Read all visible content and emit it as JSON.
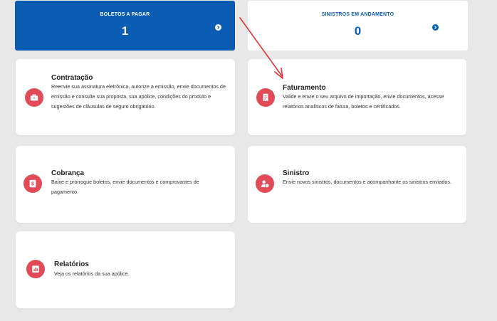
{
  "stats": {
    "boletos": {
      "label": "BOLETOS A PAGAR",
      "value": "1",
      "icon": "chevron-right-circle-icon"
    },
    "sinistros": {
      "label": "SINISTROS EM ANDAMENTO",
      "value": "0",
      "icon": "chevron-right-circle-icon"
    }
  },
  "cards": {
    "contratacao": {
      "title": "Contratação",
      "description": "Reenvie sua assinatura eletrônica, autorize a emissão, envie documentos de emissão e consulte sua proposta, sua apólice, condições do produto e sugestões de cláusulas de seguro obrigatório.",
      "icon": "briefcase-icon"
    },
    "faturamento": {
      "title": "Faturamento",
      "description": "Valide e envie o seu arquivo de importação, envie documentos, acesse relatórios analíticos de fatura, boletos e certificados.",
      "icon": "invoice-icon"
    },
    "cobranca": {
      "title": "Cobrança",
      "description": "Baixe e prorrogue boletos, envie documentos e comprovantes de pagamento.",
      "icon": "dollar-document-icon"
    },
    "sinistro": {
      "title": "Sinistro",
      "description": "Envie novos sinistros, documentos e acompanhante os sinistros enviados.",
      "icon": "user-shield-icon"
    },
    "relatorios": {
      "title": "Relatórios",
      "description": "Veja os relatórios da sua apólice.",
      "icon": "bar-chart-icon"
    }
  },
  "colors": {
    "primary": "#0a5db3",
    "icon_background": "#e14a57",
    "annotation_arrow": "#e0303e",
    "page_background": "#e9e8e9"
  }
}
